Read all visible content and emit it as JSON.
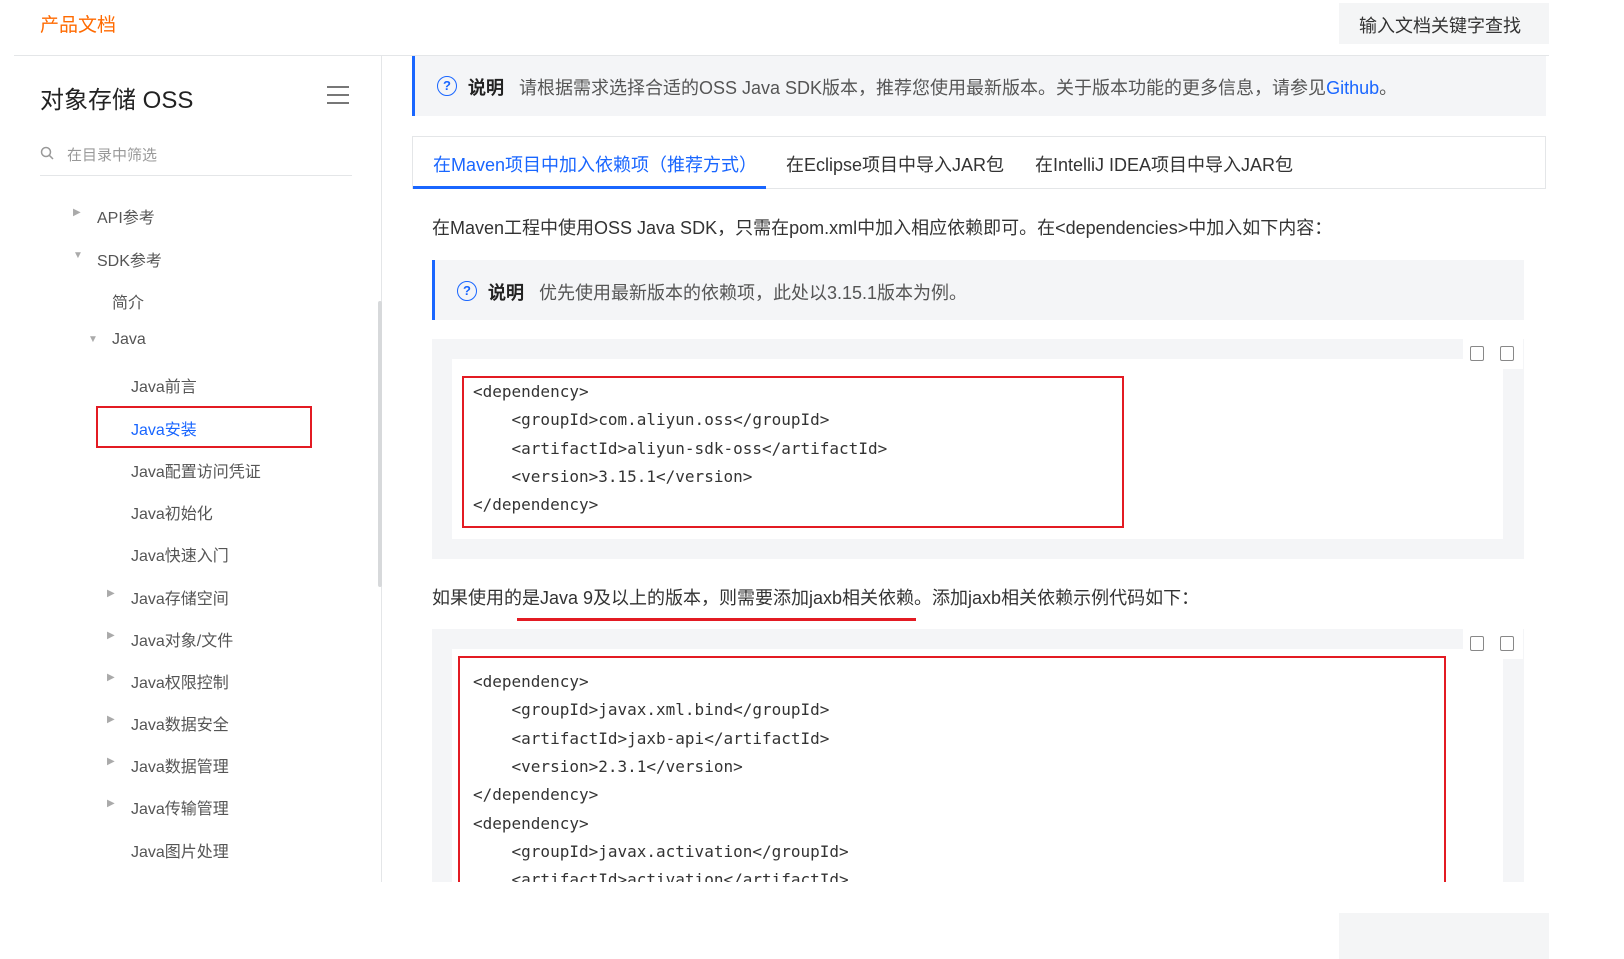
{
  "header": {
    "brand": "产品文档",
    "search_placeholder": "输入文档关键字查找"
  },
  "sidebar": {
    "title": "对象存储 OSS",
    "filter_placeholder": "在目录中筛选",
    "items": [
      {
        "label": "API参考",
        "arrow": "▶"
      },
      {
        "label": "SDK参考",
        "arrow": "▼"
      },
      {
        "label": "简介",
        "arrow": ""
      },
      {
        "label": "Java",
        "arrow": "▼"
      },
      {
        "label": "Java前言",
        "arrow": ""
      },
      {
        "label": "Java安装",
        "arrow": ""
      },
      {
        "label": "Java配置访问凭证",
        "arrow": ""
      },
      {
        "label": "Java初始化",
        "arrow": ""
      },
      {
        "label": "Java快速入门",
        "arrow": ""
      },
      {
        "label": "Java存储空间",
        "arrow": "▶"
      },
      {
        "label": "Java对象/文件",
        "arrow": "▶"
      },
      {
        "label": "Java权限控制",
        "arrow": "▶"
      },
      {
        "label": "Java数据安全",
        "arrow": "▶"
      },
      {
        "label": "Java数据管理",
        "arrow": "▶"
      },
      {
        "label": "Java传输管理",
        "arrow": "▶"
      },
      {
        "label": "Java图片处理",
        "arrow": ""
      }
    ]
  },
  "main": {
    "note_top": {
      "label": "说明",
      "text": "请根据需求选择合适的OSS Java SDK版本，推荐您使用最新版本。关于版本功能的更多信息，请参见",
      "link": "Github",
      "end": "。"
    },
    "tabs": [
      {
        "label": "在Maven项目中加入依赖项（推荐方式）"
      },
      {
        "label": "在Eclipse项目中导入JAR包"
      },
      {
        "label": "在IntelliJ IDEA项目中导入JAR包"
      }
    ],
    "intro": "在Maven工程中使用OSS Java SDK，只需在pom.xml中加入相应依赖即可。在<dependencies>中加入如下内容：",
    "note2": {
      "label": "说明",
      "text": "优先使用最新版本的依赖项，此处以3.15.1版本为例。"
    },
    "code1": [
      "<dependency>",
      "    <groupId>com.aliyun.oss</groupId>",
      "    <artifactId>aliyun-sdk-oss</artifactId>",
      "    <version>3.15.1</version>",
      "</dependency>"
    ],
    "para2": "如果使用的是Java 9及以上的版本，则需要添加jaxb相关依赖。添加jaxb相关依赖示例代码如下：",
    "code2": [
      "<dependency>",
      "    <groupId>javax.xml.bind</groupId>",
      "    <artifactId>jaxb-api</artifactId>",
      "    <version>2.3.1</version>",
      "</dependency>",
      "<dependency>",
      "    <groupId>javax.activation</groupId>",
      "    <artifactId>activation</artifactId>"
    ]
  }
}
